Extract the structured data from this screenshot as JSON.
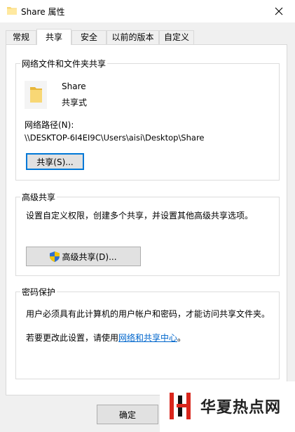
{
  "window": {
    "title": "Share 属性",
    "close_icon": "close-icon",
    "folder_icon": "folder-icon"
  },
  "tabs": [
    {
      "label": "常规"
    },
    {
      "label": "共享"
    },
    {
      "label": "安全"
    },
    {
      "label": "以前的版本"
    },
    {
      "label": "自定义"
    }
  ],
  "active_tab": "共享",
  "network_share": {
    "group_title": "网络文件和文件夹共享",
    "folder_name": "Share",
    "share_status": "共享式",
    "path_label": "网络路径(N):",
    "path_value": "\\\\DESKTOP-6I4EI9C\\Users\\aisi\\Desktop\\Share",
    "share_button": "共享(S)..."
  },
  "advanced_share": {
    "group_title": "高级共享",
    "description": "设置自定义权限，创建多个共享，并设置其他高级共享选项。",
    "button": "高级共享(D)...",
    "shield_icon": "uac-shield-icon"
  },
  "password_protection": {
    "group_title": "密码保护",
    "line1": "用户必须具有此计算机的用户帐户和密码，才能访问共享文件夹。",
    "line2_prefix": "若要更改此设置，请使用",
    "line2_link": "网络和共享中心",
    "line2_suffix": "。"
  },
  "footer": {
    "ok_button": "确定"
  },
  "watermark": {
    "text": "华夏热点网"
  },
  "colors": {
    "accent": "#0078d7",
    "link": "#0066cc",
    "folder": "#f8d775",
    "logo_red": "#d9261c"
  }
}
